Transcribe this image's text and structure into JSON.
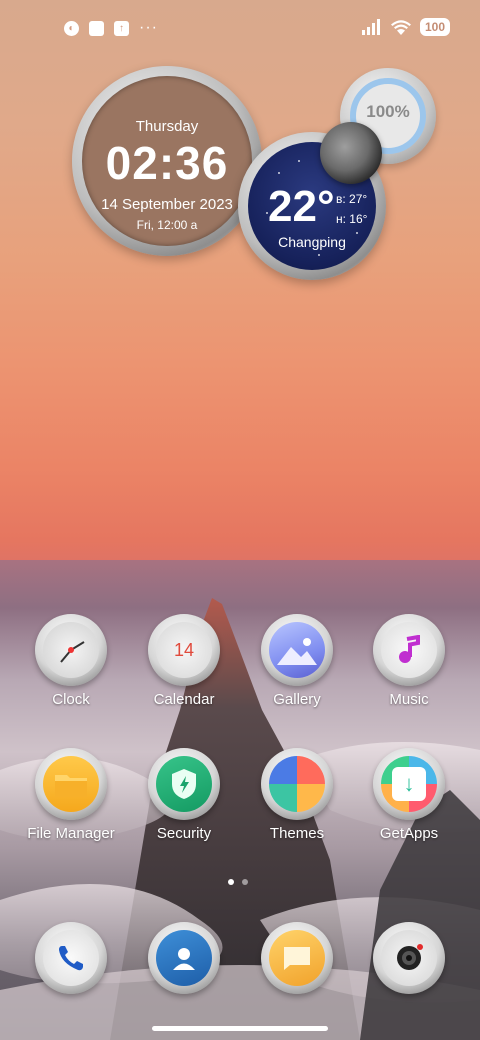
{
  "status_bar": {
    "left_icons": [
      "app-notification-icon",
      "square-notification-icon",
      "upload-notification-icon"
    ],
    "more": "···",
    "battery": "100"
  },
  "clock_widget": {
    "day": "Thursday",
    "time": "02:36",
    "date": "14 September 2023",
    "alarm": "Fri, 12:00 a"
  },
  "battery_widget": {
    "percent_label": "100%",
    "level": 1.0
  },
  "weather_widget": {
    "temp": "22°",
    "high": "в: 27°",
    "low": "н: 16°",
    "city": "Changping"
  },
  "apps": [
    {
      "name": "Clock",
      "icon": "clock-icon"
    },
    {
      "name": "Calendar",
      "icon": "calendar-icon",
      "badge": "14"
    },
    {
      "name": "Gallery",
      "icon": "gallery-icon"
    },
    {
      "name": "Music",
      "icon": "music-icon"
    },
    {
      "name": "File Manager",
      "icon": "folder-icon"
    },
    {
      "name": "Security",
      "icon": "shield-icon"
    },
    {
      "name": "Themes",
      "icon": "themes-icon"
    },
    {
      "name": "GetApps",
      "icon": "getapps-icon"
    }
  ],
  "dock": [
    {
      "icon": "phone-icon"
    },
    {
      "icon": "contacts-icon"
    },
    {
      "icon": "messages-icon"
    },
    {
      "icon": "camera-icon"
    }
  ],
  "page_indicator": {
    "pages": 2,
    "current": 1
  }
}
